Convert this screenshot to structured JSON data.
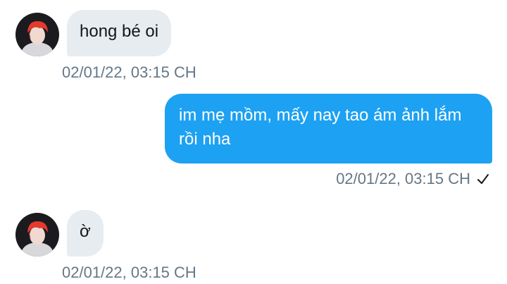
{
  "conversation": {
    "messages": [
      {
        "direction": "incoming",
        "text": "hong bé oi",
        "timestamp": "02/01/22, 03:15 CH"
      },
      {
        "direction": "outgoing",
        "text": "im mẹ mồm, mấy nay tao ám ảnh lắm rồi nha",
        "timestamp": "02/01/22, 03:15 CH",
        "status": "sent"
      },
      {
        "direction": "incoming",
        "text": "ờ",
        "timestamp": "02/01/22, 03:15 CH"
      }
    ]
  },
  "icons": {
    "avatar": "profile-avatar-icon",
    "sent_status": "check-icon"
  },
  "colors": {
    "incoming_bubble": "#e6ecf0",
    "outgoing_bubble": "#1da1f2",
    "timestamp": "#657786",
    "text": "#14171a"
  }
}
